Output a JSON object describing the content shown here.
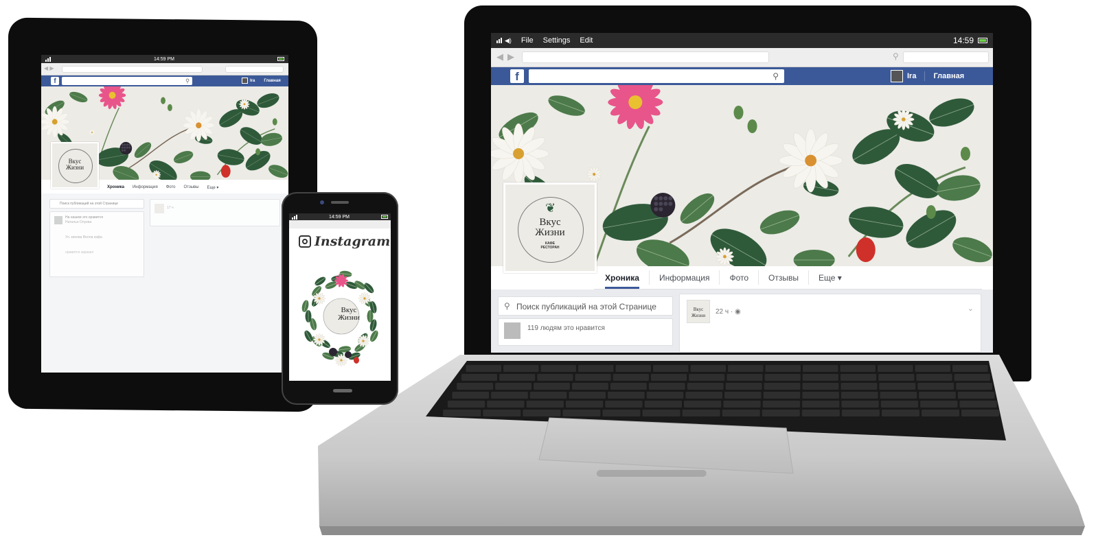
{
  "status": {
    "time_full": "14:59",
    "time_tablet": "14:59 PM",
    "time_phone": "14:59 PM"
  },
  "browser": {
    "menu": [
      "File",
      "Settings",
      "Edit"
    ]
  },
  "facebook": {
    "logo": "f",
    "user_name": "Ira",
    "home_label": "Главная",
    "page_brand_line1": "Вкус",
    "page_brand_line2": "Жизни",
    "page_brand_sub1": "КАФЕ",
    "page_brand_sub2": "РЕСТОРАН",
    "tabs": [
      "Хроника",
      "Информация",
      "Фото",
      "Отзывы",
      "Еще ▾"
    ],
    "search_placeholder": "Поиск публикаций на этой Странице",
    "likes_text": "119 людям это нравится",
    "post_meta": "22 ч · ",
    "tablet_search_placeholder": "Поиск публикаций на этой Странице",
    "tablet_likes_title": "Нa нашем это нравится",
    "tablet_likes_sub": "Наталья Олуева",
    "tablet_item2": "Ул. кинова Велла кафа",
    "tablet_item3": "нравится заразил",
    "tablet_item4": "17 ч"
  },
  "instagram": {
    "logo_text": "Instagram"
  },
  "colors": {
    "fb_blue": "#3b5998",
    "cover_bg": "#ecebe6",
    "leaf_dark": "#2f5a3a",
    "leaf_mid": "#4d7a4a",
    "flower_pink": "#e8558a",
    "flower_white": "#f7f5ef"
  },
  "icons": [
    "signal-icon",
    "wifi-icon",
    "battery-icon",
    "back-arrow-icon",
    "forward-arrow-icon",
    "search-icon",
    "facebook-logo-icon",
    "instagram-camera-icon",
    "globe-icon",
    "chevron-down-icon"
  ]
}
